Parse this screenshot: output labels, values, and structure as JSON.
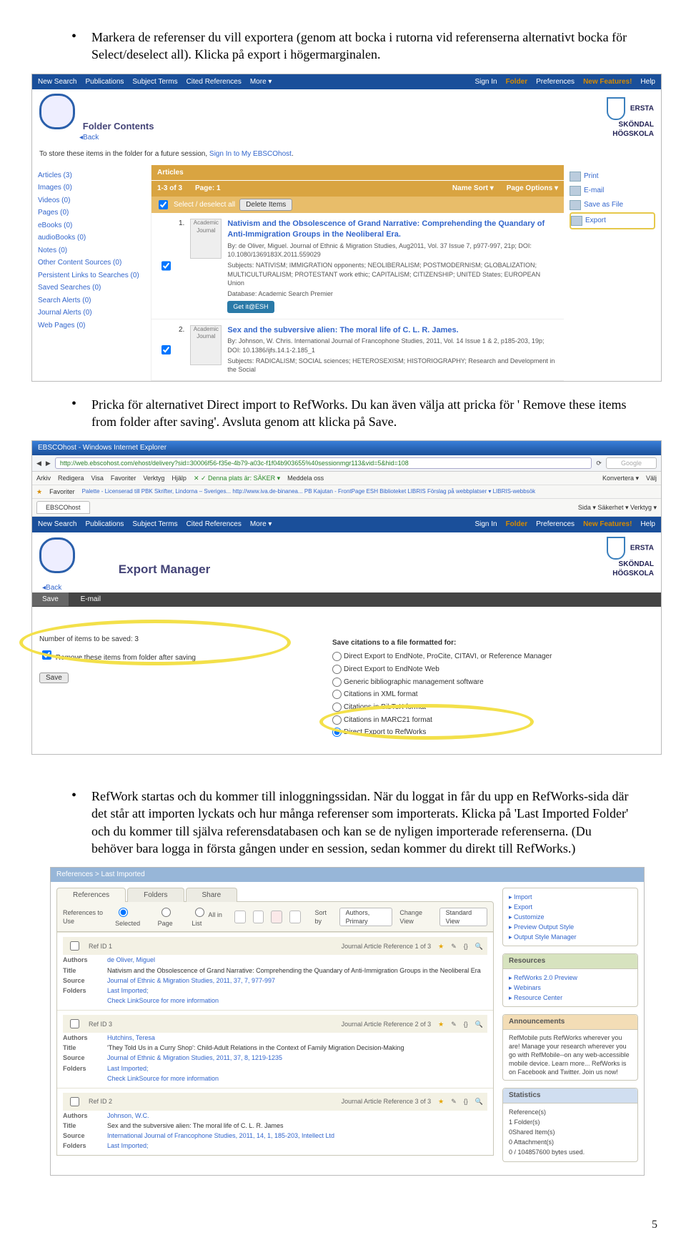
{
  "page_number": "5",
  "bullets": {
    "b1": "Markera de referenser du vill exportera (genom att bocka i rutorna vid referenserna alternativt bocka för Select/deselect all). Klicka på export i högermarginalen.",
    "b2": "Pricka för alternativet Direct import to RefWorks. Du kan även välja att pricka för ' Remove these items from folder after saving'. Avsluta genom att klicka på Save.",
    "b3": "RefWork startas och du kommer till inloggningssidan. När du loggat in får du upp en RefWorks-sida där det står att importen lyckats och hur många referenser som importerats. Klicka på 'Last Imported Folder' och du kommer till själva referensdatabasen och kan se de nyligen importerade referenserna. (Du behöver bara logga in första gången under en session, sedan kommer du direkt till RefWorks.)"
  },
  "ebsco": {
    "nav": {
      "new_search": "New Search",
      "publications": "Publications",
      "subject_terms": "Subject Terms",
      "cited": "Cited References",
      "more": "More ▾",
      "sign_in": "Sign In",
      "folder": "Folder",
      "prefs": "Preferences",
      "newfeat": "New Features!",
      "help": "Help"
    },
    "folder_contents": "Folder Contents",
    "back": "◂Back",
    "store_msg_1": "To store these items in the folder for a future session, ",
    "store_link": "Sign In to My EBSCOhost",
    "store_msg_2": ".",
    "institution": {
      "l1": "ERSTA",
      "l2": "SKÖNDAL",
      "l3": "HÖGSKOLA"
    },
    "sidebar": [
      "Articles (3)",
      "Images (0)",
      "Videos (0)",
      "Pages (0)",
      "eBooks (0)",
      "audioBooks (0)",
      "Notes (0)",
      "Other Content Sources (0)",
      "Persistent Links to Searches (0)",
      "Saved Searches (0)",
      "Search Alerts (0)",
      "Journal Alerts (0)",
      "Web Pages (0)"
    ],
    "orange_bar": {
      "articles": "Articles",
      "range": "1-3 of 3",
      "page": "Page: 1",
      "sort": "Name Sort ▾",
      "options": "Page Options ▾"
    },
    "orange_bar2": {
      "select": "Select / deselect all",
      "delete": "Delete Items"
    },
    "tools": {
      "print": "Print",
      "email": "E-mail",
      "save": "Save as File",
      "export": "Export"
    },
    "articles": [
      {
        "n": "1.",
        "thumb": "Academic Journal",
        "title": "Nativism and the Obsolescence of Grand Narrative: Comprehending the Quandary of Anti-Immigration Groups in the Neoliberal Era.",
        "by": "By: de Oliver, Miguel. Journal of Ethnic & Migration Studies, Aug2011, Vol. 37 Issue 7, p977-997, 21p; DOI: 10.1080/1369183X.2011.559029",
        "subjects": "Subjects: NATIVISM; IMMIGRATION opponents; NEOLIBERALISM; POSTMODERNISM; GLOBALIZATION; MULTICULTURALISM; PROTESTANT work ethic; CAPITALISM; CITIZENSHIP; UNITED States; EUROPEAN Union",
        "db": "Database: Academic Search Premier",
        "getit": "Get it@ESH"
      },
      {
        "n": "2.",
        "thumb": "Academic Journal",
        "title": "Sex and the subversive alien: The moral life of C. L. R. James.",
        "by": "By: Johnson, W. Chris. International Journal of Francophone Studies, 2011, Vol. 14 Issue 1 & 2, p185-203, 19p; DOI: 10.1386/ijfs.14.1-2.185_1",
        "subjects": "Subjects: RADICALISM; SOCIAL sciences; HETEROSEXISM; HISTORIOGRAPHY; Research and Development in the Social"
      }
    ]
  },
  "browser": {
    "title": "EBSCOhost - Windows Internet Explorer",
    "url": "http://web.ebscohost.com/ehost/delivery?sid=30006f56-f35e-4b79-a03c-f1f04b903655%40sessionmgr113&vid=5&hid=108",
    "menu": [
      "Arkiv",
      "Redigera",
      "Visa",
      "Favoriter",
      "Verktyg",
      "Hjälp"
    ],
    "status_site": "Denna plats är: SÄKER ▾",
    "status_notify": "Meddela oss",
    "konv": "Konvertera ▾",
    "valj": "Välj",
    "fav": "Favoriter",
    "favlinks": "Palette - Licenserad till PBK    Skrifter, Lindorna – Sveriges...    http://www.iva.de-binanea...    PB Kajutan - FrontPage    ESH Biblioteket    LIBRIS    Förslag på webbplatser ▾    LIBRIS-webbsök",
    "tab": "EBSCOhost",
    "tabright": "Sida ▾   Säkerhet ▾   Verktyg ▾"
  },
  "export_manager": {
    "title": "Export Manager",
    "tab_save": "Save",
    "tab_email": "E-mail",
    "count": "Number of items to be saved: 3",
    "remove": "Remove these items from folder after saving",
    "save_btn": "Save",
    "right_title": "Save citations to a file formatted for:",
    "opts": [
      "Direct Export to EndNote, ProCite, CITAVI, or Reference Manager",
      "Direct Export to EndNote Web",
      "Generic bibliographic management software",
      "Citations in XML format",
      "Citations in BibTeX format",
      "Citations in MARC21 format",
      "Direct Export to RefWorks"
    ]
  },
  "refworks": {
    "crumb": "References > Last Imported",
    "tabs": {
      "refs": "References",
      "folders": "Folders",
      "share": "Share"
    },
    "toolbar": {
      "use": "References to Use",
      "sel": "Selected",
      "page": "Page",
      "all": "All in List",
      "sortby": "Sort by",
      "sort_val": "Authors, Primary",
      "view": "Change View",
      "view_val": "Standard View"
    },
    "quick": {
      "h": "",
      "items": [
        "Import",
        "Export",
        "Customize",
        "Preview Output Style",
        "Output Style Manager"
      ]
    },
    "resources": {
      "h": "Resources",
      "items": [
        "RefWorks 2.0 Preview",
        "Webinars",
        "Resource Center"
      ]
    },
    "announce": {
      "h": "Announcements",
      "body": "RefMobile puts RefWorks wherever you are! Manage your research wherever you go with RefMobile--on any web-accessible mobile device. Learn more... RefWorks is on Facebook and Twitter. Join us now!"
    },
    "stats": {
      "h": "Statistics",
      "lines": [
        "Reference(s)",
        "1 Folder(s)",
        "0Shared Item(s)",
        "0 Attachment(s)",
        "0 / 104857600 bytes used."
      ]
    },
    "items": [
      {
        "id": "Ref ID    1",
        "type": "Journal Article Reference 1 of 3",
        "authors": "de Oliver, Miguel",
        "title": "Nativism and the Obsolescence of Grand Narrative: Comprehending the Quandary of Anti-Immigration Groups in the Neoliberal Era",
        "source": "Journal of Ethnic & Migration Studies, 2011, 37, 7, 977-997",
        "folders": "Last Imported;",
        "link": "Check LinkSource for more information"
      },
      {
        "id": "Ref ID    3",
        "type": "Journal Article Reference 2 of 3",
        "authors": "Hutchins, Teresa",
        "title": "'They Told Us in a Curry Shop': Child-Adult Relations in the Context of Family Migration Decision-Making",
        "source": "Journal of Ethnic & Migration Studies, 2011, 37, 8, 1219-1235",
        "folders": "Last Imported;",
        "link": "Check LinkSource for more information"
      },
      {
        "id": "Ref ID    2",
        "type": "Journal Article Reference 3 of 3",
        "authors": "Johnson, W.C.",
        "title": "Sex and the subversive alien: The moral life of C. L. R. James",
        "source": "International Journal of Francophone Studies, 2011, 14, 1, 185-203, Intellect Ltd",
        "folders": "Last Imported;"
      }
    ]
  }
}
